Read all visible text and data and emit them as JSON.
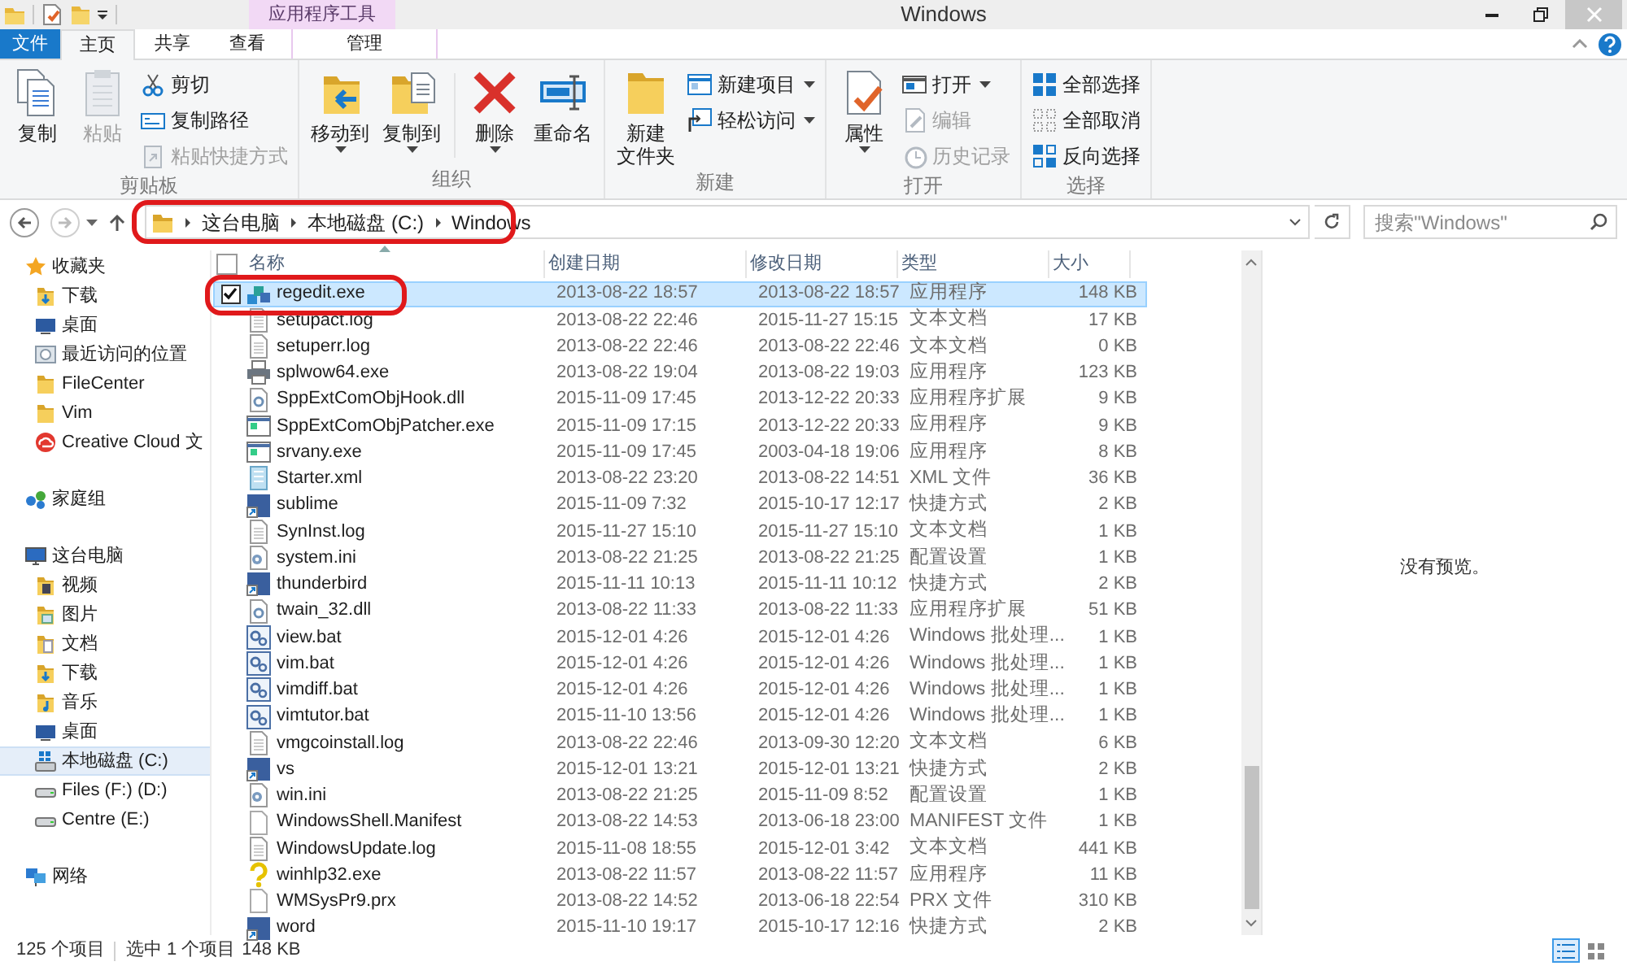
{
  "window": {
    "title": "Windows",
    "context_tab_group": "应用程序工具"
  },
  "tabs": [
    {
      "label": "文件",
      "kind": "file",
      "selected": false
    },
    {
      "label": "主页",
      "kind": "tab",
      "selected": true
    },
    {
      "label": "共享",
      "kind": "tab",
      "selected": false
    },
    {
      "label": "查看",
      "kind": "tab",
      "selected": false
    },
    {
      "label": "管理",
      "kind": "context",
      "selected": false
    }
  ],
  "ribbon": {
    "groups": [
      {
        "label": "剪贴板",
        "buttons": [
          {
            "kind": "large",
            "label": "复制",
            "disabled": false,
            "dropdown": false
          },
          {
            "kind": "large",
            "label": "粘贴",
            "disabled": true,
            "dropdown": false
          },
          {
            "kind": "stack",
            "items": [
              {
                "label": "剪切",
                "disabled": false,
                "dropdown": false
              },
              {
                "label": "复制路径",
                "disabled": false,
                "dropdown": false
              },
              {
                "label": "粘贴快捷方式",
                "disabled": true,
                "dropdown": false
              }
            ]
          }
        ]
      },
      {
        "label": "组织",
        "buttons": [
          {
            "kind": "large",
            "label": "移动到",
            "disabled": false,
            "dropdown": true
          },
          {
            "kind": "large",
            "label": "复制到",
            "disabled": false,
            "dropdown": true
          },
          {
            "kind": "separator"
          },
          {
            "kind": "large",
            "label": "删除",
            "disabled": false,
            "dropdown": true
          },
          {
            "kind": "large",
            "label": "重命名",
            "disabled": false,
            "dropdown": false
          }
        ]
      },
      {
        "label": "新建",
        "buttons": [
          {
            "kind": "large",
            "label_lines": [
              "新建",
              "文件夹"
            ],
            "disabled": false,
            "dropdown": false
          },
          {
            "kind": "stack",
            "items": [
              {
                "label": "新建项目",
                "disabled": false,
                "dropdown": true
              },
              {
                "label": "轻松访问",
                "disabled": false,
                "dropdown": true
              }
            ]
          }
        ]
      },
      {
        "label": "打开",
        "buttons": [
          {
            "kind": "large",
            "label": "属性",
            "disabled": false,
            "dropdown": true
          },
          {
            "kind": "stack",
            "items": [
              {
                "label": "打开",
                "disabled": false,
                "dropdown": true
              },
              {
                "label": "编辑",
                "disabled": true,
                "dropdown": false
              },
              {
                "label": "历史记录",
                "disabled": true,
                "dropdown": false
              }
            ]
          }
        ]
      },
      {
        "label": "选择",
        "buttons": [
          {
            "kind": "stack",
            "items": [
              {
                "label": "全部选择",
                "disabled": false,
                "dropdown": false
              },
              {
                "label": "全部取消",
                "disabled": false,
                "dropdown": false
              },
              {
                "label": "反向选择",
                "disabled": false,
                "dropdown": false
              }
            ]
          }
        ]
      }
    ]
  },
  "address": {
    "segments": [
      "这台电脑",
      "本地磁盘 (C:)",
      "Windows"
    ],
    "circled": true,
    "search_placeholder": "搜索\"Windows\""
  },
  "navigation": [
    {
      "label": "收藏夹",
      "kind": "star",
      "selected": false,
      "children": [
        {
          "label": "下载",
          "kind": "download",
          "selected": false
        },
        {
          "label": "桌面",
          "kind": "desktop",
          "selected": false
        },
        {
          "label": "最近访问的位置",
          "kind": "recent",
          "selected": false
        },
        {
          "label": "FileCenter",
          "kind": "folder",
          "selected": false
        },
        {
          "label": "Vim",
          "kind": "folder",
          "selected": false
        },
        {
          "label": "Creative Cloud 文",
          "kind": "cloud",
          "selected": false
        }
      ]
    },
    {
      "label": "家庭组",
      "kind": "homegroup",
      "selected": false
    },
    {
      "label": "这台电脑",
      "kind": "pc",
      "selected": false,
      "children": [
        {
          "label": "视频",
          "kind": "video",
          "selected": false
        },
        {
          "label": "图片",
          "kind": "picture",
          "selected": false
        },
        {
          "label": "文档",
          "kind": "document",
          "selected": false
        },
        {
          "label": "下载",
          "kind": "download",
          "selected": false
        },
        {
          "label": "音乐",
          "kind": "music",
          "selected": false
        },
        {
          "label": "桌面",
          "kind": "desktop",
          "selected": false
        },
        {
          "label": "本地磁盘 (C:)",
          "kind": "systemdrive",
          "selected": true
        },
        {
          "label": "Files (F:) (D:)",
          "kind": "drive",
          "selected": false
        },
        {
          "label": "Centre (E:)",
          "kind": "drive",
          "selected": false
        }
      ]
    },
    {
      "label": "网络",
      "kind": "network",
      "selected": false
    }
  ],
  "file_list": {
    "select_all_checked": false,
    "columns": [
      "名称",
      "创建日期",
      "修改日期",
      "类型",
      "大小"
    ],
    "rows": [
      {
        "name": "regedit.exe",
        "kind": "registry",
        "created": "2013-08-22 18:57",
        "modified": "2013-08-22 18:57",
        "type": "应用程序",
        "size": "148 KB",
        "selected": true,
        "checked": true,
        "circled": true
      },
      {
        "name": "setupact.log",
        "kind": "text",
        "created": "2013-08-22 22:46",
        "modified": "2015-11-27 15:15",
        "type": "文本文档",
        "size": "17 KB",
        "selected": false,
        "checked": false,
        "circled": false
      },
      {
        "name": "setuperr.log",
        "kind": "text",
        "created": "2013-08-22 22:46",
        "modified": "2013-08-22 22:46",
        "type": "文本文档",
        "size": "0 KB",
        "selected": false,
        "checked": false,
        "circled": false
      },
      {
        "name": "splwow64.exe",
        "kind": "printer",
        "created": "2013-08-22 19:04",
        "modified": "2013-08-22 19:03",
        "type": "应用程序",
        "size": "123 KB",
        "selected": false,
        "checked": false,
        "circled": false
      },
      {
        "name": "SppExtComObjHook.dll",
        "kind": "dll",
        "created": "2015-11-09 17:45",
        "modified": "2013-12-22 20:33",
        "type": "应用程序扩展",
        "size": "9 KB",
        "selected": false,
        "checked": false,
        "circled": false
      },
      {
        "name": "SppExtComObjPatcher.exe",
        "kind": "app",
        "created": "2015-11-09 17:15",
        "modified": "2013-12-22 20:33",
        "type": "应用程序",
        "size": "9 KB",
        "selected": false,
        "checked": false,
        "circled": false
      },
      {
        "name": "srvany.exe",
        "kind": "app",
        "created": "2015-11-09 17:45",
        "modified": "2003-04-18 19:06",
        "type": "应用程序",
        "size": "8 KB",
        "selected": false,
        "checked": false,
        "circled": false
      },
      {
        "name": "Starter.xml",
        "kind": "xml",
        "created": "2013-08-22 23:20",
        "modified": "2013-08-22 14:51",
        "type": "XML 文件",
        "size": "36 KB",
        "selected": false,
        "checked": false,
        "circled": false
      },
      {
        "name": "sublime",
        "kind": "shortcut",
        "created": "2015-11-09 7:32",
        "modified": "2015-10-17 12:17",
        "type": "快捷方式",
        "size": "2 KB",
        "selected": false,
        "checked": false,
        "circled": false
      },
      {
        "name": "SynInst.log",
        "kind": "text",
        "created": "2015-11-27 15:10",
        "modified": "2015-11-27 15:10",
        "type": "文本文档",
        "size": "1 KB",
        "selected": false,
        "checked": false,
        "circled": false
      },
      {
        "name": "system.ini",
        "kind": "ini",
        "created": "2013-08-22 21:25",
        "modified": "2013-08-22 21:25",
        "type": "配置设置",
        "size": "1 KB",
        "selected": false,
        "checked": false,
        "circled": false
      },
      {
        "name": "thunderbird",
        "kind": "shortcut",
        "created": "2015-11-11 10:13",
        "modified": "2015-11-11 10:12",
        "type": "快捷方式",
        "size": "2 KB",
        "selected": false,
        "checked": false,
        "circled": false
      },
      {
        "name": "twain_32.dll",
        "kind": "dll",
        "created": "2013-08-22 11:33",
        "modified": "2013-08-22 11:33",
        "type": "应用程序扩展",
        "size": "51 KB",
        "selected": false,
        "checked": false,
        "circled": false
      },
      {
        "name": "view.bat",
        "kind": "batch",
        "created": "2015-12-01 4:26",
        "modified": "2015-12-01 4:26",
        "type": "Windows 批处理...",
        "size": "1 KB",
        "selected": false,
        "checked": false,
        "circled": false
      },
      {
        "name": "vim.bat",
        "kind": "batch",
        "created": "2015-12-01 4:26",
        "modified": "2015-12-01 4:26",
        "type": "Windows 批处理...",
        "size": "1 KB",
        "selected": false,
        "checked": false,
        "circled": false
      },
      {
        "name": "vimdiff.bat",
        "kind": "batch",
        "created": "2015-12-01 4:26",
        "modified": "2015-12-01 4:26",
        "type": "Windows 批处理...",
        "size": "1 KB",
        "selected": false,
        "checked": false,
        "circled": false
      },
      {
        "name": "vimtutor.bat",
        "kind": "batch",
        "created": "2015-11-10 13:56",
        "modified": "2015-12-01 4:26",
        "type": "Windows 批处理...",
        "size": "1 KB",
        "selected": false,
        "checked": false,
        "circled": false
      },
      {
        "name": "vmgcoinstall.log",
        "kind": "text",
        "created": "2013-08-22 22:46",
        "modified": "2013-09-30 12:20",
        "type": "文本文档",
        "size": "6 KB",
        "selected": false,
        "checked": false,
        "circled": false
      },
      {
        "name": "vs",
        "kind": "shortcut",
        "created": "2015-12-01 13:21",
        "modified": "2015-12-01 13:21",
        "type": "快捷方式",
        "size": "2 KB",
        "selected": false,
        "checked": false,
        "circled": false
      },
      {
        "name": "win.ini",
        "kind": "ini",
        "created": "2013-08-22 21:25",
        "modified": "2015-11-09 8:52",
        "type": "配置设置",
        "size": "1 KB",
        "selected": false,
        "checked": false,
        "circled": false
      },
      {
        "name": "WindowsShell.Manifest",
        "kind": "blank",
        "created": "2013-08-22 14:53",
        "modified": "2013-06-18 23:00",
        "type": "MANIFEST 文件",
        "size": "1 KB",
        "selected": false,
        "checked": false,
        "circled": false
      },
      {
        "name": "WindowsUpdate.log",
        "kind": "text",
        "created": "2015-11-08 18:55",
        "modified": "2015-12-01 3:42",
        "type": "文本文档",
        "size": "441 KB",
        "selected": false,
        "checked": false,
        "circled": false
      },
      {
        "name": "winhlp32.exe",
        "kind": "help",
        "created": "2013-08-22 11:57",
        "modified": "2013-08-22 11:57",
        "type": "应用程序",
        "size": "11 KB",
        "selected": false,
        "checked": false,
        "circled": false
      },
      {
        "name": "WMSysPr9.prx",
        "kind": "blank",
        "created": "2013-08-22 14:52",
        "modified": "2013-06-18 22:54",
        "type": "PRX 文件",
        "size": "310 KB",
        "selected": false,
        "checked": false,
        "circled": false
      },
      {
        "name": "word",
        "kind": "shortcut",
        "created": "2015-11-10 19:17",
        "modified": "2015-10-17 12:16",
        "type": "快捷方式",
        "size": "2 KB",
        "selected": false,
        "checked": false,
        "circled": false
      }
    ]
  },
  "preview": {
    "message": "没有预览。"
  },
  "status_bar": {
    "item_count": "125 个项目",
    "selection": "选中 1 个项目",
    "selection_size": "148 KB",
    "views": [
      {
        "kind": "details",
        "selected": true
      },
      {
        "kind": "icons",
        "selected": false
      }
    ]
  }
}
